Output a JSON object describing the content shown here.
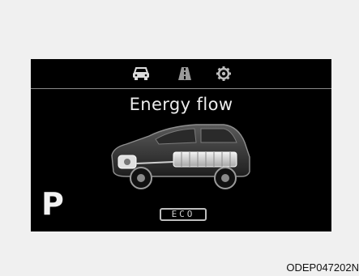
{
  "display": {
    "tab_icons": [
      "car-icon",
      "lane-icon",
      "gear-settings-icon"
    ],
    "title": "Energy flow",
    "gear_indicator": "P",
    "drive_mode": "ECO",
    "colors": {
      "background": "#000000",
      "text": "#ececec",
      "divider": "#8a8a8a",
      "battery_pack": "#d6d6d6"
    }
  },
  "figure_code": "ODEP047202N"
}
